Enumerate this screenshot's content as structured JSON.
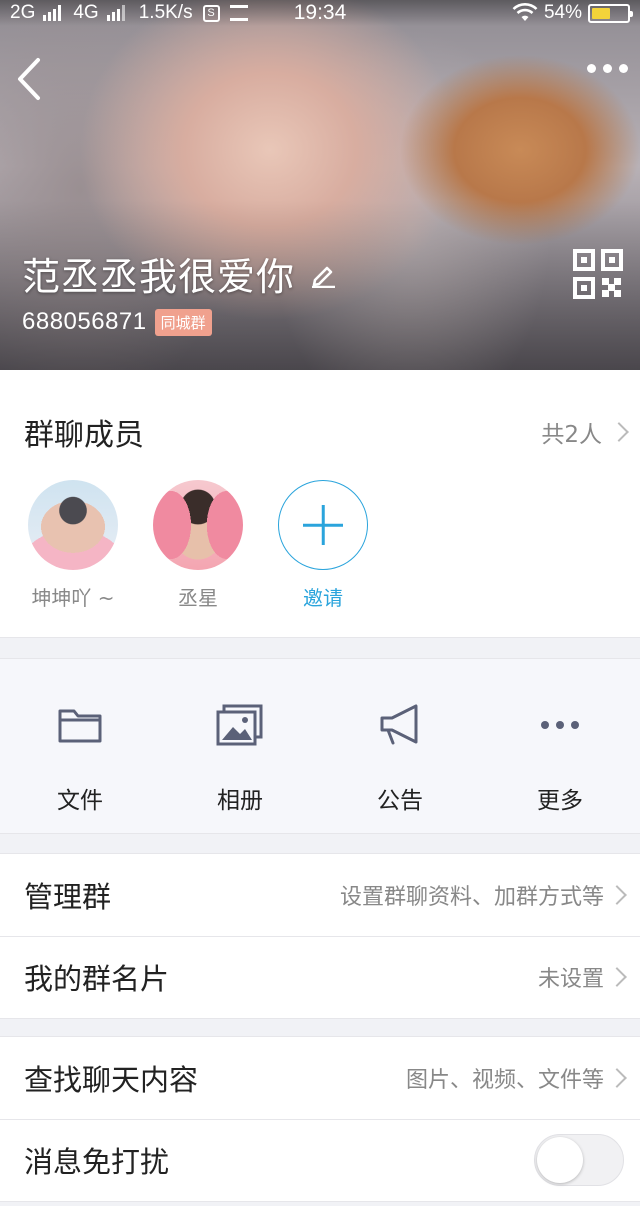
{
  "status_bar": {
    "network_1": "2G",
    "network_2": "4G",
    "speed": "1.5K/s",
    "time": "19:34",
    "battery_percent": "54%",
    "battery_level": 0.54
  },
  "header": {
    "group_name": "范丞丞我很爱你",
    "group_id": "688056871",
    "tag": "同城群"
  },
  "members": {
    "title": "群聊成员",
    "count_label": "共2人",
    "items": [
      {
        "name": "坤坤吖 ~"
      },
      {
        "name": "丞星"
      }
    ],
    "invite_label": "邀请"
  },
  "tools": {
    "files": "文件",
    "album": "相册",
    "notice": "公告",
    "more": "更多"
  },
  "settings": {
    "manage_group": {
      "title": "管理群",
      "value": "设置群聊资料、加群方式等"
    },
    "my_card": {
      "title": "我的群名片",
      "value": "未设置"
    },
    "search_chat": {
      "title": "查找聊天内容",
      "value": "图片、视频、文件等"
    },
    "do_not_disturb": {
      "title": "消息免打扰",
      "enabled": false
    }
  },
  "colors": {
    "accent": "#2aa4dc",
    "tag_bg": "#f0a18e",
    "battery": "#f3d33a"
  }
}
